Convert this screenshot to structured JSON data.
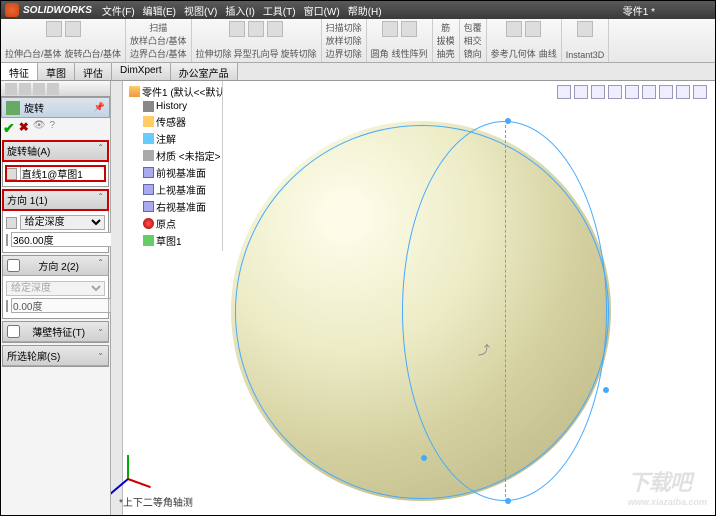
{
  "titlebar": {
    "brand": "SOLIDWORKS",
    "menus": [
      "文件(F)",
      "编辑(E)",
      "视图(V)",
      "插入(I)",
      "工具(T)",
      "窗口(W)",
      "帮助(H)"
    ],
    "doc": "零件1 *"
  },
  "ribbon": {
    "groups": [
      {
        "items": [
          "拉伸凸台/基体",
          "旋转凸台/基体"
        ]
      },
      {
        "items": [
          "扫描",
          "放样凸台/基体",
          "边界凸台/基体"
        ]
      },
      {
        "items": [
          "拉伸切除",
          "异型孔向导",
          "旋转切除"
        ]
      },
      {
        "items": [
          "扫描切除",
          "放样切除",
          "边界切除"
        ]
      },
      {
        "items": [
          "圆角",
          "线性阵列"
        ]
      },
      {
        "items": [
          "筋",
          "拔模",
          "抽壳"
        ]
      },
      {
        "items": [
          "包覆",
          "相交",
          "镜向"
        ]
      },
      {
        "items": [
          "参考几何体",
          "曲线"
        ]
      },
      {
        "items": [
          "Instant3D"
        ]
      }
    ]
  },
  "tabs": [
    "特征",
    "草图",
    "评估",
    "DimXpert",
    "办公室产品"
  ],
  "pm": {
    "title": "旋转",
    "sections": {
      "axis": {
        "label": "旋转轴(A)",
        "value": "直线1@草图1"
      },
      "dir1": {
        "label": "方向 1(1)",
        "depth_type": "给定深度",
        "angle": "360.00度"
      },
      "dir2": {
        "label": "方向 2(2)",
        "depth_type": "给定深度",
        "angle": "0.00度"
      },
      "thin": {
        "label": "薄壁特征(T)"
      },
      "contour": {
        "label": "所选轮廓(S)"
      }
    }
  },
  "tree": {
    "root": "零件1 (默认<<默认...",
    "items": [
      {
        "icon": "hist",
        "label": "History"
      },
      {
        "icon": "sensor",
        "label": "传感器"
      },
      {
        "icon": "ann",
        "label": "注解"
      },
      {
        "icon": "mat",
        "label": "材质 <未指定>"
      },
      {
        "icon": "plane",
        "label": "前视基准面"
      },
      {
        "icon": "plane",
        "label": "上视基准面"
      },
      {
        "icon": "plane",
        "label": "右视基准面"
      },
      {
        "icon": "origin",
        "label": "原点"
      },
      {
        "icon": "sketch",
        "label": "草图1"
      }
    ]
  },
  "viewport": {
    "label": "*上下二等角轴测"
  },
  "watermark": {
    "main": "下载吧",
    "sub": "www.xiazaiba.com"
  }
}
